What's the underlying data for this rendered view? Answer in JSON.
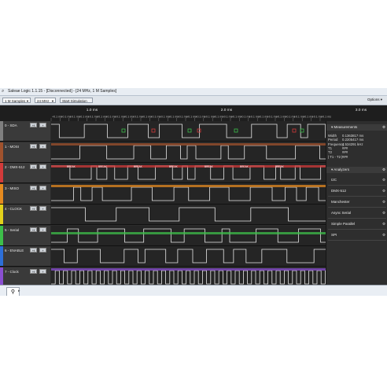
{
  "window": {
    "title": "Saleae Logic 1.1.15 - [Disconnected] - [24 MHz, 1 M Samples]",
    "icon": "logic-app-icon"
  },
  "toolbar": {
    "samples": "1 M Samples",
    "rate": "24 MHz",
    "start_label": "Start Simulation",
    "options_label": "Options"
  },
  "ruler": {
    "major": [
      "1.0 ms",
      "2.0 ms",
      "3.0 ms"
    ],
    "minor_label": "+0.1 ms"
  },
  "channels": [
    {
      "label": "0 - SDA",
      "color": "#7f7f7f"
    },
    {
      "label": "1 - MOSI",
      "color": "#a0522d"
    },
    {
      "label": "2 - DMX-512",
      "color": "#d23a3a"
    },
    {
      "label": "3 - MISO",
      "color": "#e58a1f"
    },
    {
      "label": "4 - CLOCK",
      "color": "#e3d11b"
    },
    {
      "label": "5 - Serial",
      "color": "#3dbf4a"
    },
    {
      "label": "6 - ENABLE",
      "color": "#2d6fd8"
    },
    {
      "label": "7 - Clock",
      "color": "#8a4fd1"
    }
  ],
  "channel_buttons": [
    "+f",
    "+"
  ],
  "dmx_annotation": "BREAK",
  "measurements": {
    "header": "Measurements",
    "rows": [
      {
        "k": "Width",
        "v": "0.1363817 ms"
      },
      {
        "k": "Period",
        "v": "0.2205417 ms"
      },
      {
        "k": "Frequency",
        "v": "4.534291 kHz"
      },
      {
        "k": "T1",
        "v": "###"
      },
      {
        "k": "T2",
        "v": "###"
      },
      {
        "k": "| T1 - T2 |",
        "v": "###"
      }
    ]
  },
  "analyzers": {
    "header": "Analyzers",
    "items": [
      "I2C",
      "DMX-512",
      "Manchester",
      "Async Serial",
      "Simple Parallel",
      "SPI"
    ]
  },
  "status_tab_icon": "search-icon"
}
